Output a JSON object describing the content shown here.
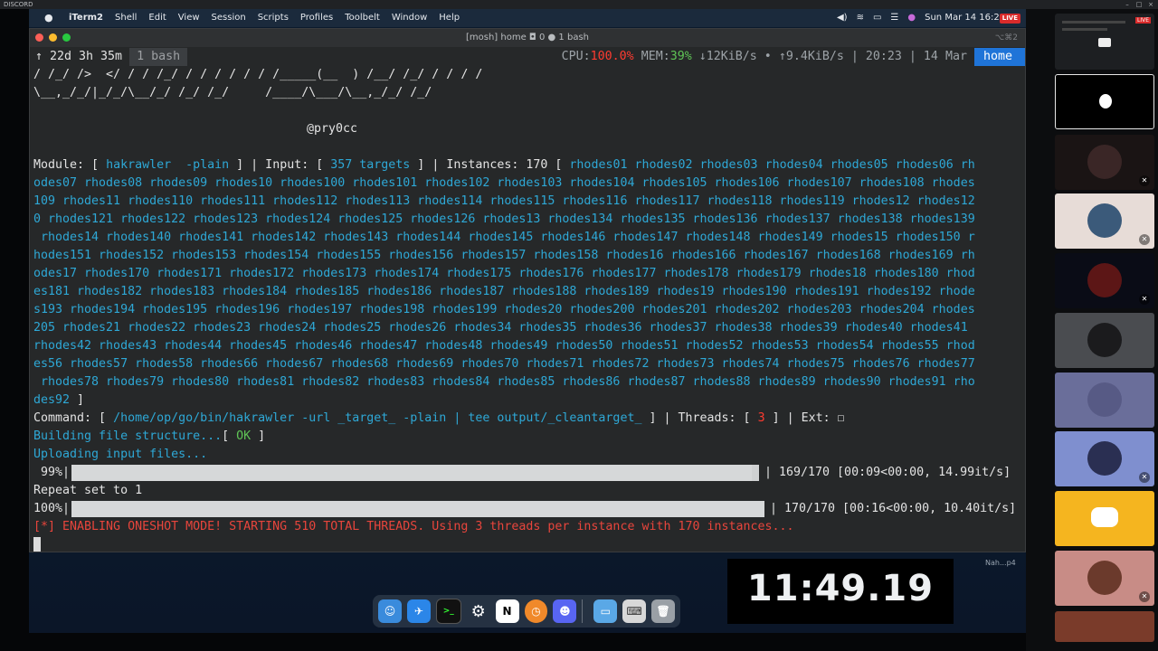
{
  "window_label": "DISCORD",
  "menubar": {
    "apple_icon": "apple-icon",
    "items": [
      "iTerm2",
      "Shell",
      "Edit",
      "View",
      "Session",
      "Scripts",
      "Profiles",
      "Toolbelt",
      "Window",
      "Help"
    ],
    "datetime": "Sun Mar 14  16:2",
    "live": "LIVE"
  },
  "iterm": {
    "title": "[mosh] home ◘ 0 ● 1 bash",
    "shortcut": "⌥⌘2",
    "status": {
      "uptime": "↑ 22d 3h 35m",
      "tab": "1 bash",
      "cpu_label": "CPU:",
      "cpu_value": "100.0%",
      "mem_label": " MEM:",
      "mem_value": "39%",
      "net": " ↓12KiB/s • ↑9.4KiB/s | 20:23 | 14 Mar",
      "host": "home"
    },
    "lines": {
      "ascii1": "/ /_/ />  </ / / /_/ / / / / / / /_____(__  ) /__/ /_/ / / / /",
      "ascii2": "\\__,_/_/|_/_/\\__/_/ /_/ /_/     /____/\\___/\\__,_/_/ /_/",
      "author": "@pry0cc",
      "module_label": "Module: [ ",
      "module_value": "hakrawler  -plain",
      "input_label": " ] | Input: [ ",
      "input_value": "357 targets",
      "instances_label": " ] | Instances: 170 [ ",
      "instances_first": "rhodes01 rhodes02 rhodes03 rhodes04 rhodes05 rhodes06 rh",
      "instances_wrap": [
        "odes07 rhodes08 rhodes09 rhodes10 rhodes100 rhodes101 rhodes102 rhodes103 rhodes104 rhodes105 rhodes106 rhodes107 rhodes108 rhodes",
        "109 rhodes11 rhodes110 rhodes111 rhodes112 rhodes113 rhodes114 rhodes115 rhodes116 rhodes117 rhodes118 rhodes119 rhodes12 rhodes12",
        "0 rhodes121 rhodes122 rhodes123 rhodes124 rhodes125 rhodes126 rhodes13 rhodes134 rhodes135 rhodes136 rhodes137 rhodes138 rhodes139",
        " rhodes14 rhodes140 rhodes141 rhodes142 rhodes143 rhodes144 rhodes145 rhodes146 rhodes147 rhodes148 rhodes149 rhodes15 rhodes150 r",
        "hodes151 rhodes152 rhodes153 rhodes154 rhodes155 rhodes156 rhodes157 rhodes158 rhodes16 rhodes166 rhodes167 rhodes168 rhodes169 rh",
        "odes17 rhodes170 rhodes171 rhodes172 rhodes173 rhodes174 rhodes175 rhodes176 rhodes177 rhodes178 rhodes179 rhodes18 rhodes180 rhod",
        "es181 rhodes182 rhodes183 rhodes184 rhodes185 rhodes186 rhodes187 rhodes188 rhodes189 rhodes19 rhodes190 rhodes191 rhodes192 rhode",
        "s193 rhodes194 rhodes195 rhodes196 rhodes197 rhodes198 rhodes199 rhodes20 rhodes200 rhodes201 rhodes202 rhodes203 rhodes204 rhodes",
        "205 rhodes21 rhodes22 rhodes23 rhodes24 rhodes25 rhodes26 rhodes34 rhodes35 rhodes36 rhodes37 rhodes38 rhodes39 rhodes40 rhodes41",
        "rhodes42 rhodes43 rhodes44 rhodes45 rhodes46 rhodes47 rhodes48 rhodes49 rhodes50 rhodes51 rhodes52 rhodes53 rhodes54 rhodes55 rhod",
        "es56 rhodes57 rhodes58 rhodes66 rhodes67 rhodes68 rhodes69 rhodes70 rhodes71 rhodes72 rhodes73 rhodes74 rhodes75 rhodes76 rhodes77",
        " rhodes78 rhodes79 rhodes80 rhodes81 rhodes82 rhodes83 rhodes84 rhodes85 rhodes86 rhodes87 rhodes88 rhodes89 rhodes90 rhodes91 rho",
        "des92"
      ],
      "instances_close": " ]",
      "command_label": "Command: [ ",
      "command_value": "/home/op/go/bin/hakrawler -url _target_ -plain | tee output/_cleantarget_",
      "threads_label": " ] | Threads: [ ",
      "threads_value": "3",
      "ext_label": " ] | Ext: ☐",
      "building": "Building file structure...",
      "building_ok_open": "[ ",
      "building_ok": "OK",
      "building_ok_close": " ]",
      "uploading": "Uploading input files...",
      "progress1_pct": " 99%|",
      "progress1_stats": "| 169/170 [00:09<00:00, 14.99it/s]",
      "progress1_fraction": 0.99,
      "repeat": "Repeat set to 1",
      "progress2_pct": "100%|",
      "progress2_stats": "| 170/170 [00:16<00:00, 10.40it/s]",
      "progress2_fraction": 1.0,
      "oneshot": "[*] ENABLING ONESHOT MODE! STARTING 510 TOTAL THREADS. Using 3 threads per instance with 170 instances..."
    }
  },
  "clock": "11:49.19",
  "desk_label": "Nah...p4",
  "dock_icons": [
    "finder-icon",
    "safari-icon",
    "terminal-icon",
    "toolbelt-icon",
    "notion-icon",
    "clock-app-icon",
    "discord-icon",
    "folder-icon",
    "keyboard-icon",
    "trash-icon"
  ],
  "colors": {
    "accent_blue": "#1f74d8",
    "cpu_red": "#ff3b30",
    "mem_green": "#5fc456",
    "cyan": "#2ea8d6",
    "alert_red": "#e8453c",
    "discord_yellow": "#f5b51f"
  }
}
